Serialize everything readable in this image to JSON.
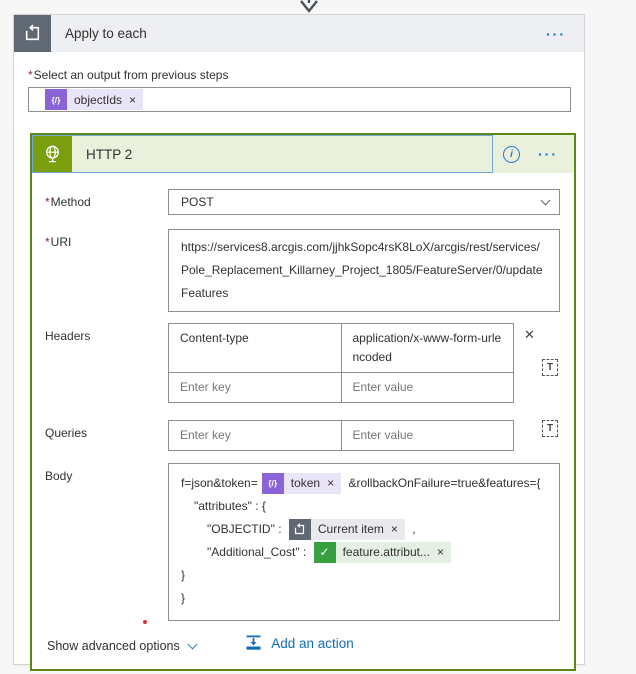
{
  "colors": {
    "accent_blue": "#0f6cbd",
    "http_green": "#7a9e0e",
    "http_border_green": "#5d8616",
    "scope_gray": "#5e6974",
    "token_purple": "#8a64d6",
    "token_green": "#36a041",
    "error_red": "#d13438"
  },
  "glyphs": {
    "ellipsis": "···",
    "info": "i",
    "close": "✕",
    "chip_close": "×",
    "text_mode": "T",
    "dynamic_content": "{/}",
    "check": "✓"
  },
  "apply_to_each": {
    "title": "Apply to each",
    "required_marker": "*",
    "output_label": "Select an output from previous steps",
    "token": {
      "label": "objectIds"
    }
  },
  "http": {
    "title": "HTTP 2",
    "method": {
      "label": "Method",
      "required_marker": "*",
      "value": "POST"
    },
    "uri": {
      "label": "URI",
      "required_marker": "*",
      "value": "https://services8.arcgis.com/jjhkSopc4rsK8LoX/arcgis/rest/services/Pole_Replacement_Killarney_Project_1805/FeatureServer/0/updateFeatures"
    },
    "headers": {
      "label": "Headers",
      "row1": {
        "key": "Content-type",
        "value": "application/x-www-form-urlencoded"
      },
      "key_placeholder": "Enter key",
      "value_placeholder": "Enter value"
    },
    "queries": {
      "label": "Queries",
      "key_placeholder": "Enter key",
      "value_placeholder": "Enter value"
    },
    "body": {
      "label": "Body",
      "line1_pre": "f=json&token=",
      "token1": "token",
      "line1_post": " &rollbackOnFailure=true&features={",
      "line2": "\"attributes\" : {",
      "line3_pre": "\"OBJECTID\" : ",
      "token2": "Current item",
      "line3_post": " ,",
      "line4_pre": "\"Additional_Cost\" : ",
      "token3": "feature.attribut...",
      "line5": "}",
      "line6": "}"
    },
    "show_advanced": "Show advanced options"
  },
  "footer": {
    "add_action": "Add an action"
  }
}
